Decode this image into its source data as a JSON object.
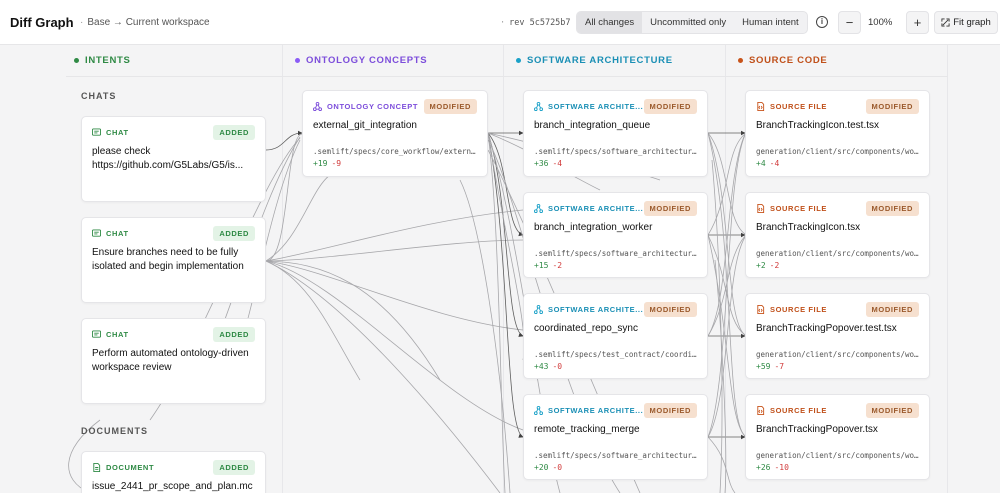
{
  "header": {
    "title": "Diff Graph",
    "base_label": "Base → Current workspace",
    "rev_label": "rev 5c5725b7",
    "filters": [
      {
        "label": "All changes",
        "active": true
      },
      {
        "label": "Uncommitted only",
        "active": false
      },
      {
        "label": "Human intent",
        "active": false
      }
    ],
    "zoom_minus": "−",
    "zoom_value": "100%",
    "zoom_plus": "+",
    "fit_label": "Fit graph",
    "info_icon": "i"
  },
  "columns": [
    {
      "label": "INTENTS",
      "color": "#2f8a45"
    },
    {
      "label": "ONTOLOGY CONCEPTS",
      "color": "#8b5cf6"
    },
    {
      "label": "SOFTWARE ARCHITECTURE",
      "color": "#1aa1c8"
    },
    {
      "label": "SOURCE CODE",
      "color": "#c8531a"
    }
  ],
  "intents": {
    "sections": [
      "CHATS",
      "DOCUMENTS"
    ],
    "cards": [
      {
        "type": "CHAT",
        "badge": "ADDED",
        "title": "please check https://github.com/G5Labs/G5/is..."
      },
      {
        "type": "CHAT",
        "badge": "ADDED",
        "title": "Ensure branches need to be fully isolated and begin implementation"
      },
      {
        "type": "CHAT",
        "badge": "ADDED",
        "title": "Perform automated ontology-driven workspace review"
      },
      {
        "type": "DOCUMENT",
        "badge": "ADDED",
        "title": "issue_2441_pr_scope_and_plan.mc"
      }
    ]
  },
  "ontology": {
    "cards": [
      {
        "type": "ONTOLOGY CONCEPT",
        "badge": "MODIFIED",
        "title": "external_git_integration",
        "path": ".semlift/specs/core_workflow/external_git_integration",
        "plus": "+19",
        "minus": "-9"
      }
    ]
  },
  "architecture": {
    "cards": [
      {
        "type": "SOFTWARE ARCHITE...",
        "badge": "MODIFIED",
        "title": "branch_integration_queue",
        "path": ".semlift/specs/software_architecture/branch_integration_queue",
        "plus": "+36",
        "minus": "-4"
      },
      {
        "type": "SOFTWARE ARCHITE...",
        "badge": "MODIFIED",
        "title": "branch_integration_worker",
        "path": ".semlift/specs/software_architecture/branch_integration_worker",
        "plus": "+15",
        "minus": "-2"
      },
      {
        "type": "SOFTWARE ARCHITE...",
        "badge": "MODIFIED",
        "title": "coordinated_repo_sync",
        "path": ".semlift/specs/test_contract/coordinated_repo_sync",
        "plus": "+43",
        "minus": "-0"
      },
      {
        "type": "SOFTWARE ARCHITE...",
        "badge": "MODIFIED",
        "title": "remote_tracking_merge",
        "path": ".semlift/specs/software_architecture/remote_tracking_merge",
        "plus": "+20",
        "minus": "-0"
      }
    ]
  },
  "source": {
    "cards": [
      {
        "type": "SOURCE FILE",
        "badge": "MODIFIED",
        "title": "BranchTrackingIcon.test.tsx",
        "path": "generation/client/src/components/workspace",
        "plus": "+4",
        "minus": "-4"
      },
      {
        "type": "SOURCE FILE",
        "badge": "MODIFIED",
        "title": "BranchTrackingIcon.tsx",
        "path": "generation/client/src/components/workspace",
        "plus": "+2",
        "minus": "-2"
      },
      {
        "type": "SOURCE FILE",
        "badge": "MODIFIED",
        "title": "BranchTrackingPopover.test.tsx",
        "path": "generation/client/src/components/workspace",
        "plus": "+59",
        "minus": "-7"
      },
      {
        "type": "SOURCE FILE",
        "badge": "MODIFIED",
        "title": "BranchTrackingPopover.tsx",
        "path": "generation/client/src/components/workspace",
        "plus": "+26",
        "minus": "-10"
      }
    ]
  }
}
